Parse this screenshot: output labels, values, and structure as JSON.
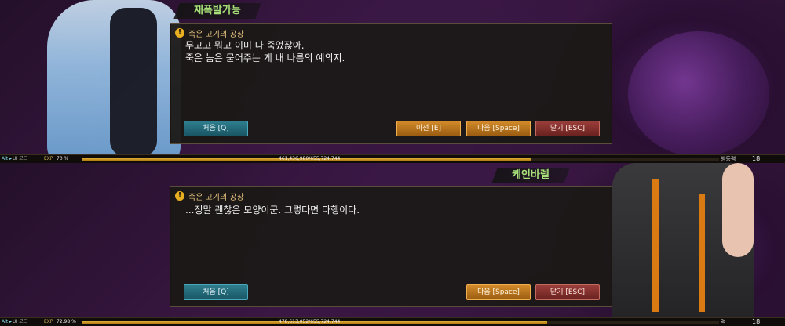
{
  "panels": [
    {
      "speaker": "재폭발가능",
      "quest_title": "죽은 고기의 공장",
      "dialog_lines": [
        "무고고 뭐고 이미 다 죽었잖아.",
        "죽은 놈은 묻어주는 게 내 나름의 예의지."
      ],
      "buttons": {
        "first": "처음 [Q]",
        "prev": "이전 [E]",
        "next": "다음 [Space]",
        "close": "닫기 [ESC]"
      },
      "status": {
        "alt": "Alt ▸",
        "ui_mode": "UI 모드",
        "exp_label": "EXP",
        "exp_pct": "70 %",
        "exp_fraction": 0.704,
        "exp_numbers": "461,436,980/655,724,744",
        "action_label": "행동력",
        "level": "18"
      }
    },
    {
      "speaker": "케인바렐",
      "quest_title": "죽은 고기의 공장",
      "dialog_lines": [
        "...정말 괜찮은 모양이군. 그렇다면 다행이다."
      ],
      "buttons": {
        "first": "처음 [Q]",
        "next": "다음 [Space]",
        "close": "닫기 [ESC]"
      },
      "status": {
        "alt": "Alt ▸",
        "ui_mode": "UI 모드",
        "exp_label": "EXP",
        "exp_pct": "72.98 %",
        "exp_fraction": 0.7298,
        "exp_numbers": "478,613,052/655,724,744",
        "action_label": "력",
        "level": "18"
      }
    }
  ],
  "colors": {
    "accent_teal": "#2e7d8e",
    "accent_orange": "#d28a2a",
    "accent_red": "#9a3e3a",
    "speaker_green": "#a8e07a"
  }
}
